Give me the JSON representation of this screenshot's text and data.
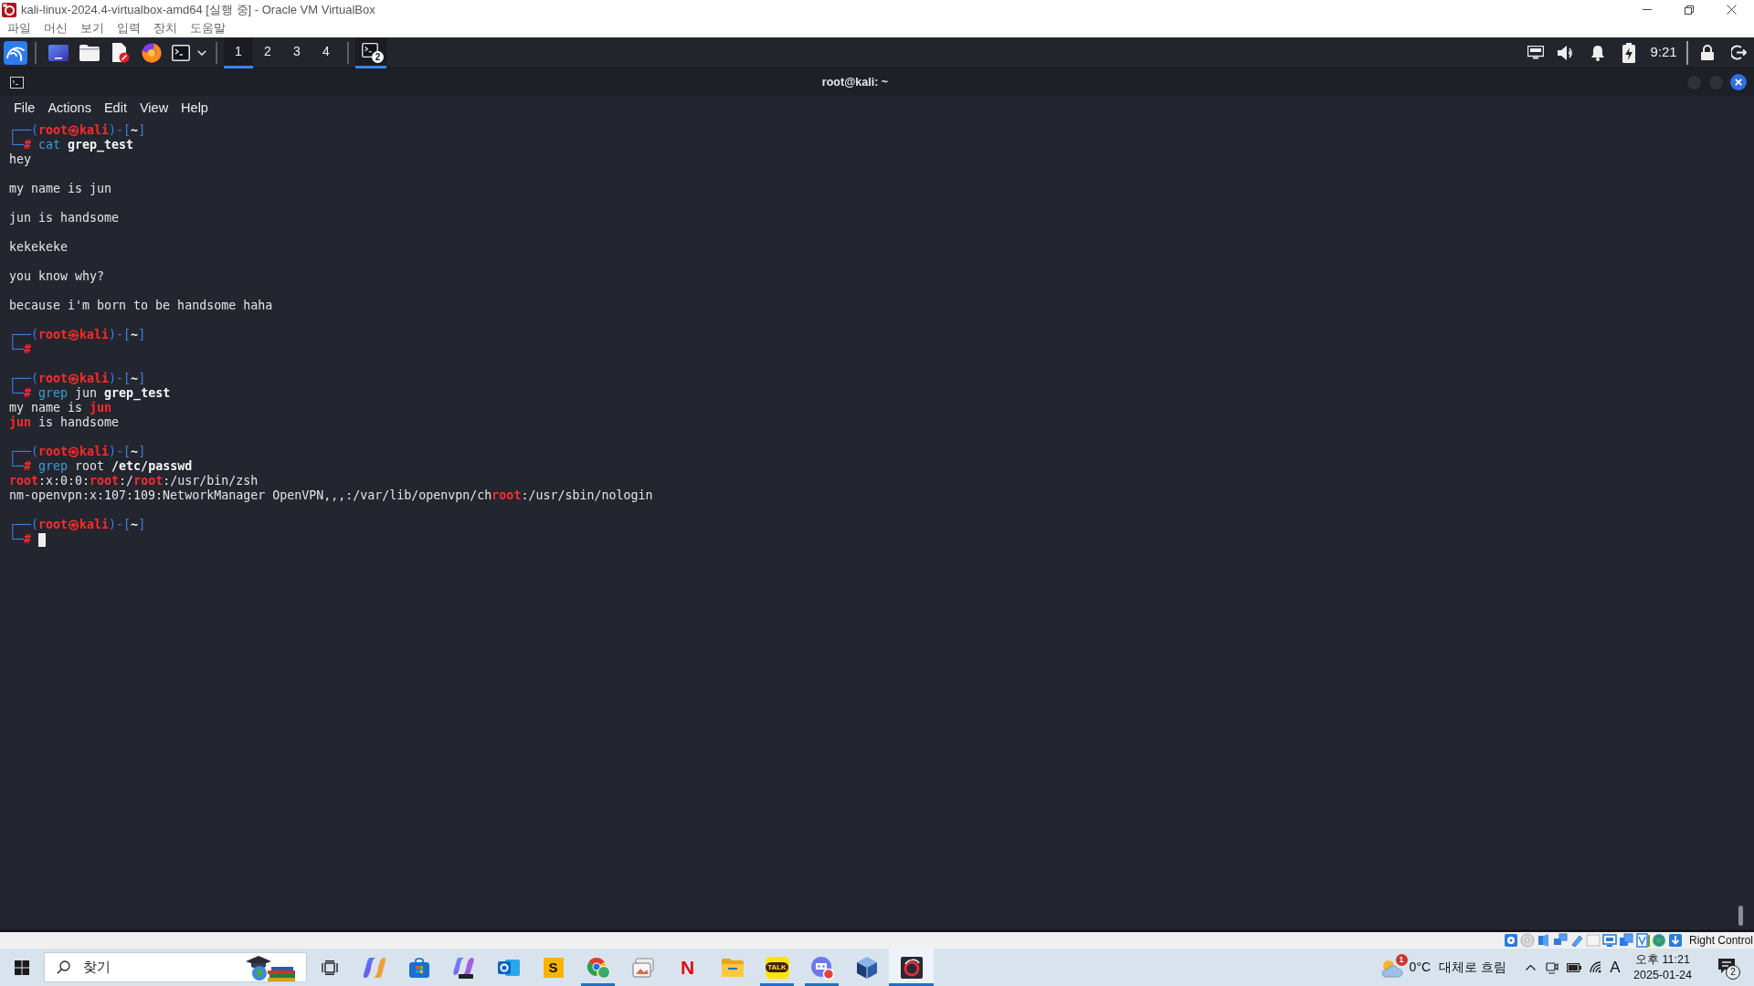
{
  "window": {
    "title": "kali-linux-2024.4-virtualbox-amd64 [실행 중] - Oracle VM VirtualBox"
  },
  "menu": [
    {
      "label": "파일"
    },
    {
      "label": "머신"
    },
    {
      "label": "보기"
    },
    {
      "label": "입력"
    },
    {
      "label": "장치"
    },
    {
      "label": "도움말"
    }
  ],
  "kali_panel": {
    "workspaces": [
      {
        "label": "1",
        "selected": true
      },
      {
        "label": "2",
        "selected": false
      },
      {
        "label": "3",
        "selected": false
      },
      {
        "label": "4",
        "selected": false
      }
    ],
    "window_button": {
      "badge": "2",
      "selected": true
    },
    "clock": "9:21"
  },
  "terminal": {
    "title": "root@kali: ~",
    "menu": [
      {
        "label": "File"
      },
      {
        "label": "Actions"
      },
      {
        "label": "Edit"
      },
      {
        "label": "View"
      },
      {
        "label": "Help"
      }
    ],
    "lines": [
      {
        "kind": "prompt",
        "segments": [
          {
            "text": "┌──(",
            "kind": "frame"
          },
          {
            "text": "root㉿kali",
            "kind": "user"
          },
          {
            "text": ")-[",
            "kind": "frame"
          },
          {
            "text": "~",
            "kind": "dir"
          },
          {
            "text": "]",
            "kind": "frame"
          }
        ]
      },
      {
        "kind": "input",
        "cursor": false,
        "segments": [
          {
            "text": "└─",
            "kind": "frame"
          },
          {
            "text": "#",
            "kind": "user"
          },
          {
            "text": " cat",
            "kind": "command"
          },
          {
            "text": " grep_test",
            "kind": "file"
          }
        ]
      },
      {
        "kind": "output",
        "segments": [
          {
            "text": "hey",
            "kind": "plain"
          }
        ]
      },
      {
        "kind": "blank"
      },
      {
        "kind": "output",
        "segments": [
          {
            "text": "my name is jun",
            "kind": "plain"
          }
        ]
      },
      {
        "kind": "blank"
      },
      {
        "kind": "output",
        "segments": [
          {
            "text": "jun is handsome",
            "kind": "plain"
          }
        ]
      },
      {
        "kind": "blank"
      },
      {
        "kind": "output",
        "segments": [
          {
            "text": "kekekeke",
            "kind": "plain"
          }
        ]
      },
      {
        "kind": "blank"
      },
      {
        "kind": "output",
        "segments": [
          {
            "text": "you know why?",
            "kind": "plain"
          }
        ]
      },
      {
        "kind": "blank"
      },
      {
        "kind": "output",
        "segments": [
          {
            "text": "because i'm born to be handsome haha",
            "kind": "plain"
          }
        ]
      },
      {
        "kind": "blank"
      },
      {
        "kind": "prompt",
        "segments": [
          {
            "text": "┌──(",
            "kind": "frame"
          },
          {
            "text": "root㉿kali",
            "kind": "user"
          },
          {
            "text": ")-[",
            "kind": "frame"
          },
          {
            "text": "~",
            "kind": "dir"
          },
          {
            "text": "]",
            "kind": "frame"
          }
        ]
      },
      {
        "kind": "input",
        "cursor": false,
        "segments": [
          {
            "text": "└─",
            "kind": "frame"
          },
          {
            "text": "#",
            "kind": "user"
          }
        ]
      },
      {
        "kind": "blank"
      },
      {
        "kind": "prompt",
        "segments": [
          {
            "text": "┌──(",
            "kind": "frame"
          },
          {
            "text": "root㉿kali",
            "kind": "user"
          },
          {
            "text": ")-[",
            "kind": "frame"
          },
          {
            "text": "~",
            "kind": "dir"
          },
          {
            "text": "]",
            "kind": "frame"
          }
        ]
      },
      {
        "kind": "input",
        "cursor": false,
        "segments": [
          {
            "text": "└─",
            "kind": "frame"
          },
          {
            "text": "#",
            "kind": "user"
          },
          {
            "text": " grep",
            "kind": "command"
          },
          {
            "text": " jun",
            "kind": "plain"
          },
          {
            "text": " grep_test",
            "kind": "file"
          }
        ]
      },
      {
        "kind": "output",
        "segments": [
          {
            "text": "my name is ",
            "kind": "plain"
          },
          {
            "text": "jun",
            "kind": "match"
          }
        ]
      },
      {
        "kind": "output",
        "segments": [
          {
            "text": "jun",
            "kind": "match"
          },
          {
            "text": " is handsome",
            "kind": "plain"
          }
        ]
      },
      {
        "kind": "blank"
      },
      {
        "kind": "prompt",
        "segments": [
          {
            "text": "┌──(",
            "kind": "frame"
          },
          {
            "text": "root㉿kali",
            "kind": "user"
          },
          {
            "text": ")-[",
            "kind": "frame"
          },
          {
            "text": "~",
            "kind": "dir"
          },
          {
            "text": "]",
            "kind": "frame"
          }
        ]
      },
      {
        "kind": "input",
        "cursor": false,
        "segments": [
          {
            "text": "└─",
            "kind": "frame"
          },
          {
            "text": "#",
            "kind": "user"
          },
          {
            "text": " grep",
            "kind": "command"
          },
          {
            "text": " root",
            "kind": "plain"
          },
          {
            "text": " /etc/passwd",
            "kind": "file"
          }
        ]
      },
      {
        "kind": "output",
        "segments": [
          {
            "text": "root",
            "kind": "match"
          },
          {
            "text": ":x:0:0:",
            "kind": "plain"
          },
          {
            "text": "root",
            "kind": "match"
          },
          {
            "text": ":/",
            "kind": "plain"
          },
          {
            "text": "root",
            "kind": "match"
          },
          {
            "text": ":/usr/bin/zsh",
            "kind": "plain"
          }
        ]
      },
      {
        "kind": "output",
        "segments": [
          {
            "text": "nm-openvpn:x:107:109:NetworkManager OpenVPN,,,:/var/lib/openvpn/ch",
            "kind": "plain"
          },
          {
            "text": "root",
            "kind": "match"
          },
          {
            "text": ":/usr/sbin/nologin",
            "kind": "plain"
          }
        ]
      },
      {
        "kind": "blank"
      },
      {
        "kind": "prompt",
        "segments": [
          {
            "text": "┌──(",
            "kind": "frame"
          },
          {
            "text": "root㉿kali",
            "kind": "user"
          },
          {
            "text": ")-[",
            "kind": "frame"
          },
          {
            "text": "~",
            "kind": "dir"
          },
          {
            "text": "]",
            "kind": "frame"
          }
        ]
      },
      {
        "kind": "input",
        "cursor": true,
        "segments": [
          {
            "text": "└─",
            "kind": "frame"
          },
          {
            "text": "#",
            "kind": "user"
          }
        ]
      }
    ]
  },
  "vm_status": {
    "host_key": "Right Control"
  },
  "taskbar": {
    "search": {
      "placeholder": "찾기"
    },
    "apps": [
      {
        "kind": "taskview",
        "running": false,
        "selected": false
      },
      {
        "kind": "swirl",
        "running": false,
        "selected": false
      },
      {
        "kind": "bag",
        "running": false,
        "selected": false
      },
      {
        "kind": "swirl_tile",
        "running": false,
        "selected": false
      },
      {
        "kind": "ring_tile",
        "running": false,
        "selected": false
      },
      {
        "kind": "letter_tile",
        "label": "S",
        "running": false,
        "selected": false
      },
      {
        "kind": "circle_logo",
        "running": true,
        "selected": false
      },
      {
        "kind": "photos",
        "running": false,
        "selected": false
      },
      {
        "kind": "letter_logo",
        "label": "N",
        "running": false,
        "selected": false
      },
      {
        "kind": "folder",
        "running": false,
        "selected": false
      },
      {
        "kind": "chat_tile",
        "label": "TALK",
        "running": true,
        "selected": false
      },
      {
        "kind": "chat_circle",
        "running": true,
        "selected": false
      },
      {
        "kind": "cube",
        "running": false,
        "selected": false
      },
      {
        "kind": "vm",
        "running": true,
        "selected": true
      }
    ],
    "weather": {
      "badge": "1",
      "temperature": "0°C",
      "condition": "대체로 흐림"
    },
    "input_mode": "A",
    "time": "오후 11:21",
    "date": "2025-01-24",
    "notification_count": "2"
  }
}
